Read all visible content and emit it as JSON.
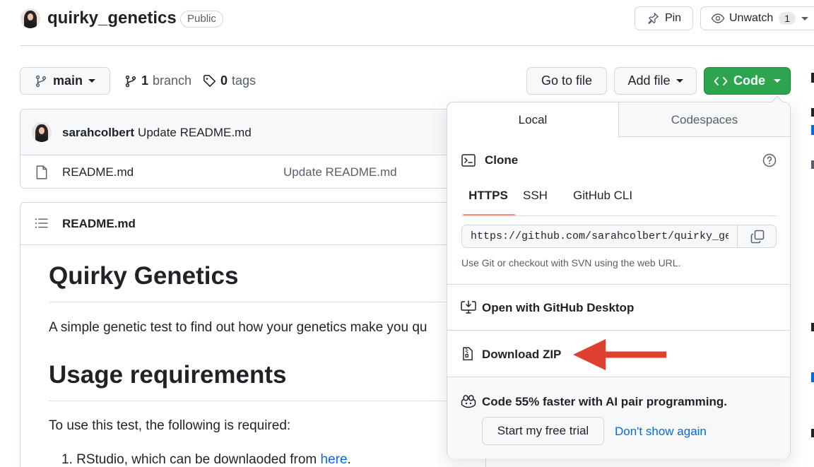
{
  "repo": {
    "name": "quirky_genetics",
    "visibility": "Public",
    "pin_label": "Pin",
    "unwatch_label": "Unwatch",
    "watch_count": "1"
  },
  "toolbar": {
    "branch_name": "main",
    "branch_count": "1",
    "branch_label": "branch",
    "tag_count": "0",
    "tag_label": "tags",
    "go_to_file": "Go to file",
    "add_file": "Add file",
    "code": "Code"
  },
  "commit": {
    "author": "sarahcolbert",
    "message": "Update README.md"
  },
  "files": [
    {
      "name": "README.md",
      "commit_message": "Update README.md"
    }
  ],
  "readme": {
    "header": "README.md",
    "title": "Quirky Genetics",
    "intro": "A simple genetic test to find out how your genetics make you qu",
    "section_title": "Usage requirements",
    "section_text": "To use this test, the following is required:",
    "list_item_prefix": "RStudio, which can be downlaoded from ",
    "list_item_link": "here",
    "list_item_suffix": "."
  },
  "code_menu": {
    "tab_local": "Local",
    "tab_codespaces": "Codespaces",
    "clone_title": "Clone",
    "protocols": [
      "HTTPS",
      "SSH",
      "GitHub CLI"
    ],
    "clone_url": "https://github.com/sarahcolbert/quirky_genetics.git",
    "clone_hint": "Use Git or checkout with SVN using the web URL.",
    "open_desktop": "Open with GitHub Desktop",
    "download_zip": "Download ZIP",
    "copilot_text": "Code 55% faster with AI pair programming.",
    "trial_button": "Start my free trial",
    "dismiss_link": "Don't show again"
  },
  "colors": {
    "code_button": "#2da44e",
    "link": "#0969da",
    "arrow": "#e0402f",
    "tab_underline": "#fd8c73"
  }
}
